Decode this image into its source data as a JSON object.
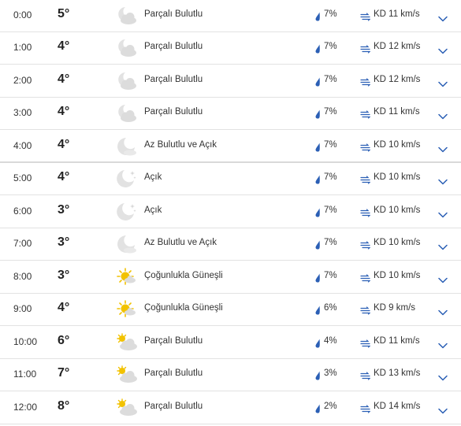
{
  "rows": [
    {
      "time": "0:00",
      "temp": "5°",
      "icon": "partly-cloudy-night-icon",
      "condition": "Parçalı Bulutlu",
      "precip": "7%",
      "wind": "KD 11 km/s"
    },
    {
      "time": "1:00",
      "temp": "4°",
      "icon": "partly-cloudy-night-icon",
      "condition": "Parçalı Bulutlu",
      "precip": "7%",
      "wind": "KD 12 km/s"
    },
    {
      "time": "2:00",
      "temp": "4°",
      "icon": "partly-cloudy-night-icon",
      "condition": "Parçalı Bulutlu",
      "precip": "7%",
      "wind": "KD 12 km/s"
    },
    {
      "time": "3:00",
      "temp": "4°",
      "icon": "partly-cloudy-night-icon",
      "condition": "Parçalı Bulutlu",
      "precip": "7%",
      "wind": "KD 11 km/s"
    },
    {
      "time": "4:00",
      "temp": "4°",
      "icon": "mostly-clear-night-icon",
      "condition": "Az Bulutlu ve Açık",
      "precip": "7%",
      "wind": "KD 10 km/s"
    },
    {
      "time": "5:00",
      "temp": "4°",
      "icon": "clear-night-icon",
      "condition": "Açık",
      "precip": "7%",
      "wind": "KD 10 km/s"
    },
    {
      "time": "6:00",
      "temp": "3°",
      "icon": "clear-night-icon",
      "condition": "Açık",
      "precip": "7%",
      "wind": "KD 10 km/s"
    },
    {
      "time": "7:00",
      "temp": "3°",
      "icon": "mostly-clear-night-icon",
      "condition": "Az Bulutlu ve Açık",
      "precip": "7%",
      "wind": "KD 10 km/s"
    },
    {
      "time": "8:00",
      "temp": "3°",
      "icon": "mostly-sunny-icon",
      "condition": "Çoğunlukla Güneşli",
      "precip": "7%",
      "wind": "KD 10 km/s"
    },
    {
      "time": "9:00",
      "temp": "4°",
      "icon": "mostly-sunny-icon",
      "condition": "Çoğunlukla Güneşli",
      "precip": "6%",
      "wind": "KD 9 km/s"
    },
    {
      "time": "10:00",
      "temp": "6°",
      "icon": "partly-cloudy-day-icon",
      "condition": "Parçalı Bulutlu",
      "precip": "4%",
      "wind": "KD 11 km/s"
    },
    {
      "time": "11:00",
      "temp": "7°",
      "icon": "partly-cloudy-day-icon",
      "condition": "Parçalı Bulutlu",
      "precip": "3%",
      "wind": "KD 13 km/s"
    },
    {
      "time": "12:00",
      "temp": "8°",
      "icon": "partly-cloudy-day-icon",
      "condition": "Parçalı Bulutlu",
      "precip": "2%",
      "wind": "KD 14 km/s"
    }
  ],
  "colors": {
    "drop": "#2b5fb5",
    "wind_icon": "#2b5fb5",
    "chevron": "#2b5fb5",
    "sun": "#f2c200",
    "moon": "#e2e2e2",
    "cloud": "#dcdcdc",
    "divider": "#e2e2e2"
  }
}
